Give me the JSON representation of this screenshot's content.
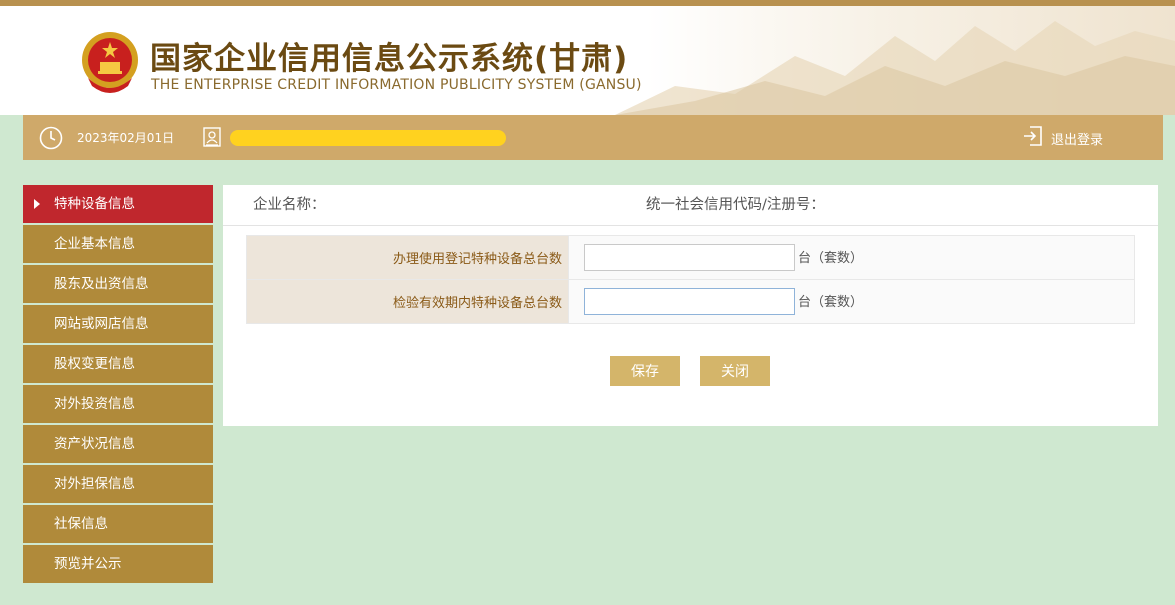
{
  "header": {
    "title_cn": "国家企业信用信息公示系统(甘肃)",
    "title_en": "THE ENTERPRISE CREDIT INFORMATION PUBLICITY SYSTEM (GANSU)"
  },
  "infobar": {
    "date": "2023年02月01日",
    "logout_label": "退出登录"
  },
  "sidebar": {
    "items": [
      {
        "label": "特种设备信息"
      },
      {
        "label": "企业基本信息"
      },
      {
        "label": "股东及出资信息"
      },
      {
        "label": "网站或网店信息"
      },
      {
        "label": "股权变更信息"
      },
      {
        "label": "对外投资信息"
      },
      {
        "label": "资产状况信息"
      },
      {
        "label": "对外担保信息"
      },
      {
        "label": "社保信息"
      },
      {
        "label": "预览并公示"
      }
    ]
  },
  "panel": {
    "company_name_label": "企业名称：",
    "credit_code_label": "统一社会信用代码/注册号："
  },
  "form": {
    "rows": [
      {
        "label": "办理使用登记特种设备总台数",
        "value": "",
        "unit": "台（套数）"
      },
      {
        "label": "检验有效期内特种设备总台数",
        "value": "",
        "unit": "台（套数）"
      }
    ]
  },
  "buttons": {
    "save_label": "保存",
    "close_label": "关闭"
  },
  "colors": {
    "accent_gold": "#cfa96a",
    "sidebar_active": "#c0272d",
    "sidebar_item": "#b08a3a",
    "page_background": "#cfe8d0",
    "button": "#d4b56a"
  }
}
